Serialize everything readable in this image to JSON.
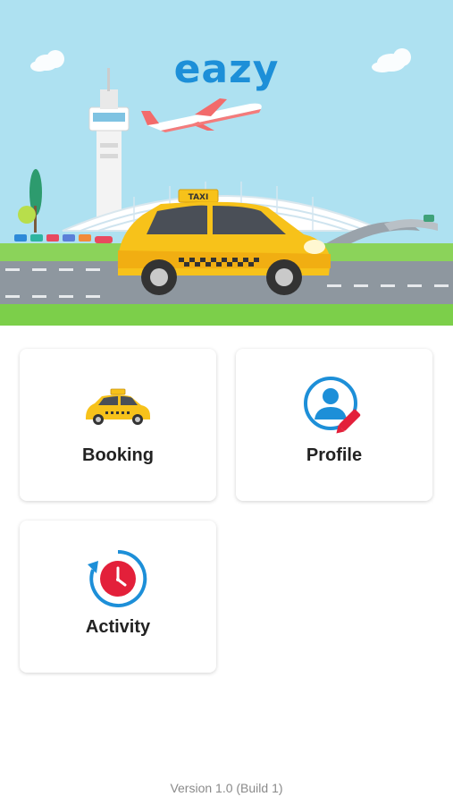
{
  "header": {
    "logo_text": "eazy",
    "taxi_sign": "TAXI"
  },
  "menu": {
    "booking_label": "Booking",
    "profile_label": "Profile",
    "activity_label": "Activity"
  },
  "footer": {
    "version_text": "Version 1.0 (Build 1)"
  },
  "icons": {
    "booking": "taxi-icon",
    "profile": "user-edit-icon",
    "activity": "history-clock-icon"
  },
  "colors": {
    "brand_blue": "#1d8fd8",
    "brand_red": "#e3203a",
    "taxi_yellow": "#f7c21a",
    "sky": "#a8dff0",
    "grass": "#7ccf4a"
  }
}
